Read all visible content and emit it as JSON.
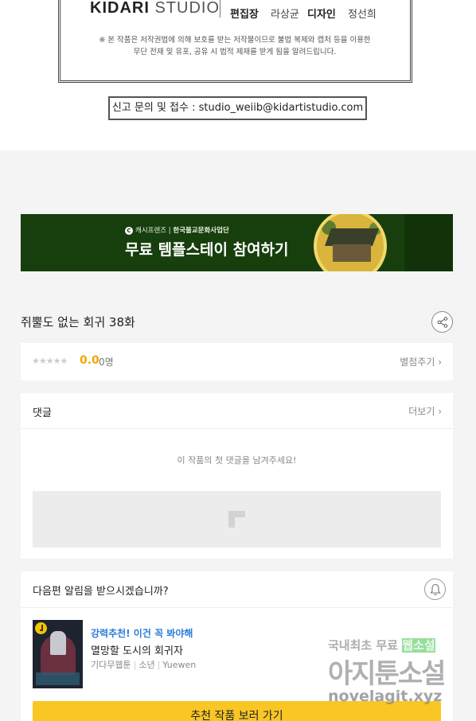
{
  "credits": {
    "logo_bold": "KIDARI",
    "logo_light": "STUDIO",
    "role1": "편집장",
    "name1": "라상균",
    "role2": "디자인",
    "name2": "정선희",
    "notice_line1": "※ 본 작품은 저작권법에 의해 보호를 받는 저작물이므로 불법 복제와 캡처 등을 이용한",
    "notice_line2": "무단 전재 및 유포, 공유 시 법적 제재를 받게 됨을 알려드립니다.",
    "report": "신고 문의 및 접수 : studio_weiib@kidartistudio.com"
  },
  "banner": {
    "sponsor": "캐시프렌즈",
    "partner": "한국불교문화사업단",
    "title": "무료 템플스테이 참여하기"
  },
  "episode": {
    "title": "쥐뿔도 없는 회귀 38화"
  },
  "rating": {
    "stars": "★★★★★",
    "score": "0.0",
    "count": "0명",
    "rate_link": "별점주기 ›"
  },
  "comments": {
    "header": "댓글",
    "more": "더보기 ›",
    "empty": "이 작품의 첫 댓글을 남겨주세요!"
  },
  "next": {
    "question": "다음편 알림을 받으시겠습니까?",
    "rec_tag": "강력추천! 이건 꼭 봐야해",
    "rec_title": "멸망할 도시의 회귀자",
    "rec_meta": [
      "기다무웹툰",
      "소년",
      "Yuewen"
    ],
    "button": "추천 작품 보러 가기"
  },
  "watermark": {
    "line1_a": "국내최초 무료",
    "line1_b": "웹소설",
    "line2": "아지툰소설",
    "line3": "novelagit.xyz"
  },
  "colors": {
    "banner_bg": "#173f0d",
    "score": "#f0a800",
    "rec_tag": "#2b7cd8",
    "button_bg": "#f9c623"
  }
}
